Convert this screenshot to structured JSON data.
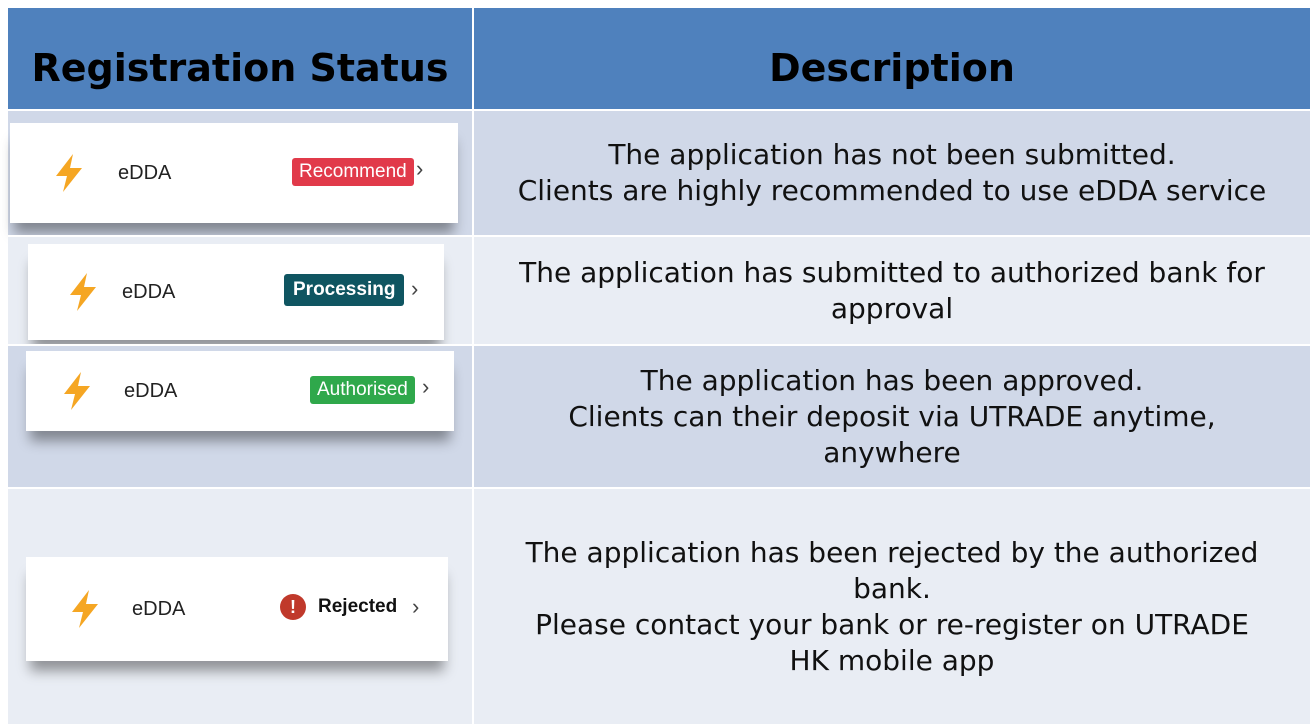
{
  "header": {
    "status_label": "Registration Status",
    "description_label": "Description"
  },
  "rows": [
    {
      "service": "eDDA",
      "badge": "Recommend",
      "badge_color": "#e13a4a",
      "description": [
        "The application has not been submitted.",
        "Clients are highly recommended to use eDDA service"
      ]
    },
    {
      "service": "eDDA",
      "badge": "Processing",
      "badge_color": "#0f5561",
      "description": [
        "The application has submitted to authorized bank for",
        "approval"
      ]
    },
    {
      "service": "eDDA",
      "badge": "Authorised",
      "badge_color": "#2fa84b",
      "description": [
        "The application has been approved.",
        "Clients can their deposit via UTRADE anytime,",
        "anywhere"
      ]
    },
    {
      "service": "eDDA",
      "badge": "Rejected",
      "badge_color": "#c0392b",
      "badge_icon": "exclamation-icon",
      "badge_icon_glyph": "!",
      "description": [
        "The application has been rejected by the authorized",
        "bank.",
        "Please contact your bank or re-register on UTRADE",
        "HK mobile app"
      ]
    }
  ],
  "icons": {
    "bolt": "lightning-bolt-icon",
    "chevron": "chevron-right-icon",
    "chevron_glyph": "›"
  },
  "colors": {
    "header_bg": "#4f81bd",
    "row_dark": "#d0d8e8",
    "row_light": "#e9edf4",
    "bolt": "#f5a623"
  }
}
